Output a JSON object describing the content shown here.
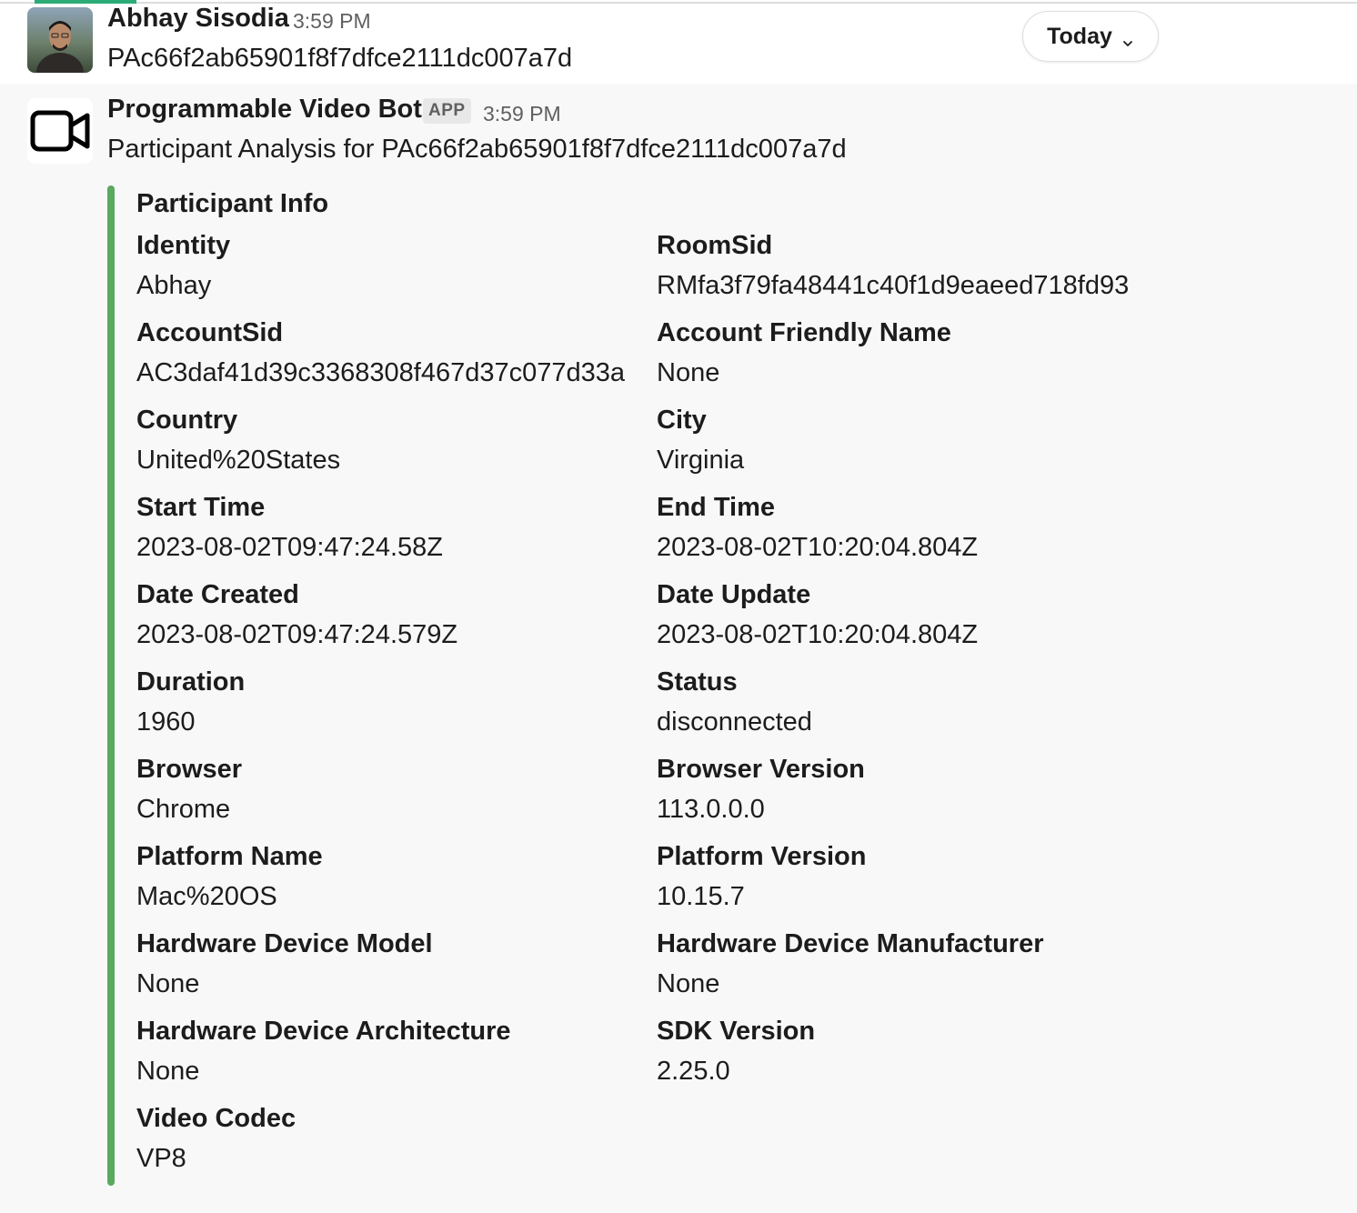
{
  "message1": {
    "author": "Abhay Sisodia",
    "time": "3:59 PM",
    "text": "PAc66f2ab65901f8f7dfce2111dc007a7d"
  },
  "date_divider": {
    "label": "Today"
  },
  "message2": {
    "author": "Programmable Video Bot",
    "badge": "APP",
    "time": "3:59 PM",
    "text": "Participant Analysis for PAc66f2ab65901f8f7dfce2111dc007a7d",
    "attachment": {
      "title": "Participant Info",
      "accent_color": "#5ba85f",
      "fields": [
        {
          "label": "Identity",
          "value": "Abhay"
        },
        {
          "label": "RoomSid",
          "value": "RMfa3f79fa48441c40f1d9eaeed718fd93"
        },
        {
          "label": "AccountSid",
          "value": "AC3daf41d39c3368308f467d37c077d33a"
        },
        {
          "label": "Account Friendly Name",
          "value": "None"
        },
        {
          "label": "Country",
          "value": "United%20States"
        },
        {
          "label": "City",
          "value": "Virginia"
        },
        {
          "label": "Start Time",
          "value": "2023-08-02T09:47:24.58Z"
        },
        {
          "label": "End Time",
          "value": "2023-08-02T10:20:04.804Z"
        },
        {
          "label": "Date Created",
          "value": "2023-08-02T09:47:24.579Z"
        },
        {
          "label": "Date Update",
          "value": "2023-08-02T10:20:04.804Z"
        },
        {
          "label": "Duration",
          "value": "1960"
        },
        {
          "label": "Status",
          "value": "disconnected"
        },
        {
          "label": "Browser",
          "value": "Chrome"
        },
        {
          "label": "Browser Version",
          "value": "113.0.0.0"
        },
        {
          "label": "Platform Name",
          "value": "Mac%20OS"
        },
        {
          "label": "Platform Version",
          "value": "10.15.7"
        },
        {
          "label": "Hardware Device Model",
          "value": "None"
        },
        {
          "label": "Hardware Device Manufacturer",
          "value": "None"
        },
        {
          "label": "Hardware Device Architecture",
          "value": "None"
        },
        {
          "label": "SDK Version",
          "value": "2.25.0"
        },
        {
          "label": "Video Codec",
          "value": "VP8"
        }
      ]
    }
  },
  "icons": {
    "avatar": "user-avatar",
    "bot": "video-camera-icon",
    "dropdown": "chevron-down-icon"
  }
}
